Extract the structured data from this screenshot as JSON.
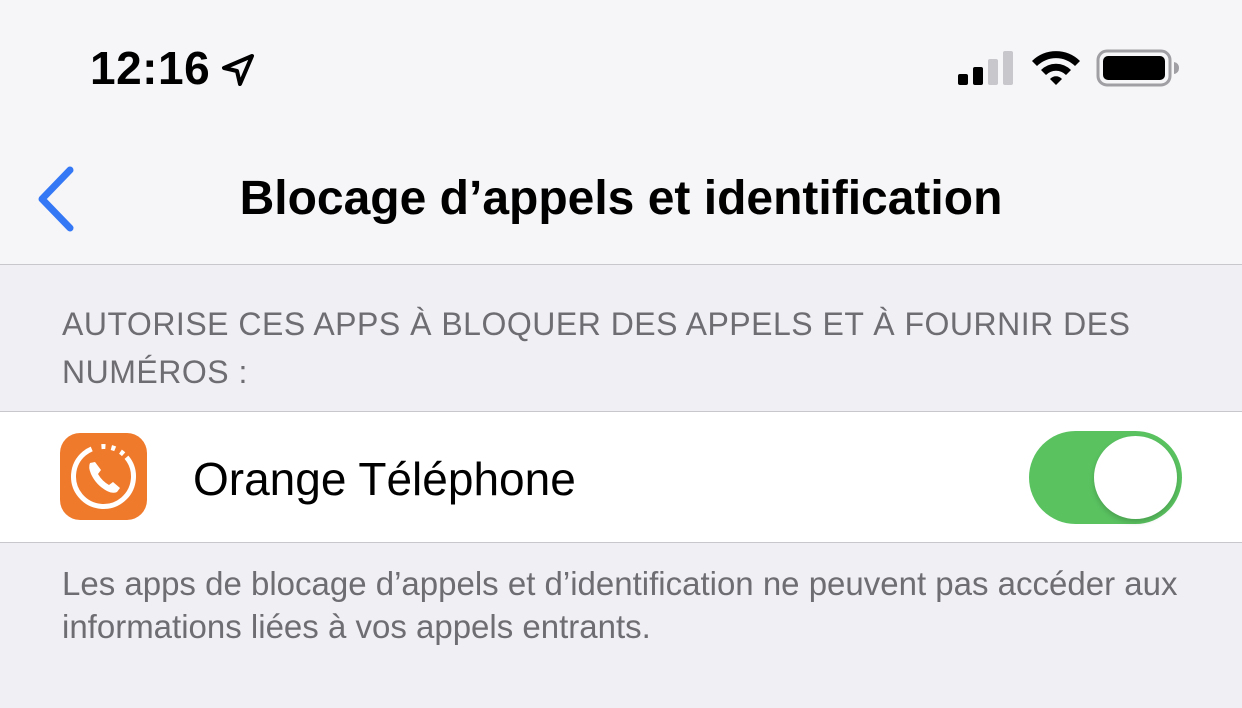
{
  "status_bar": {
    "time": "12:16",
    "icons": [
      "location-arrow-icon",
      "cellular-signal-icon",
      "wifi-icon",
      "battery-icon"
    ]
  },
  "nav": {
    "title": "Blocage d’appels et identification",
    "back_icon": "chevron-left-icon"
  },
  "section": {
    "header": "AUTORISE CES APPS À BLOQUER DES APPELS ET À FOURNIR DES NUMÉROS :",
    "items": [
      {
        "label": "Orange Téléphone",
        "icon": "orange-telephone-app-icon",
        "toggle_on": true
      }
    ],
    "footer": "Les apps de blocage d’appels et d’identification ne peuvent pas accéder aux informations liées à vos appels entrants."
  },
  "colors": {
    "accent": "#3478f6",
    "toggle_on": "#5ac360",
    "app_icon_bg": "#f07a2c",
    "secondary_text": "#6d6d72",
    "grouped_background": "#efeff4"
  }
}
